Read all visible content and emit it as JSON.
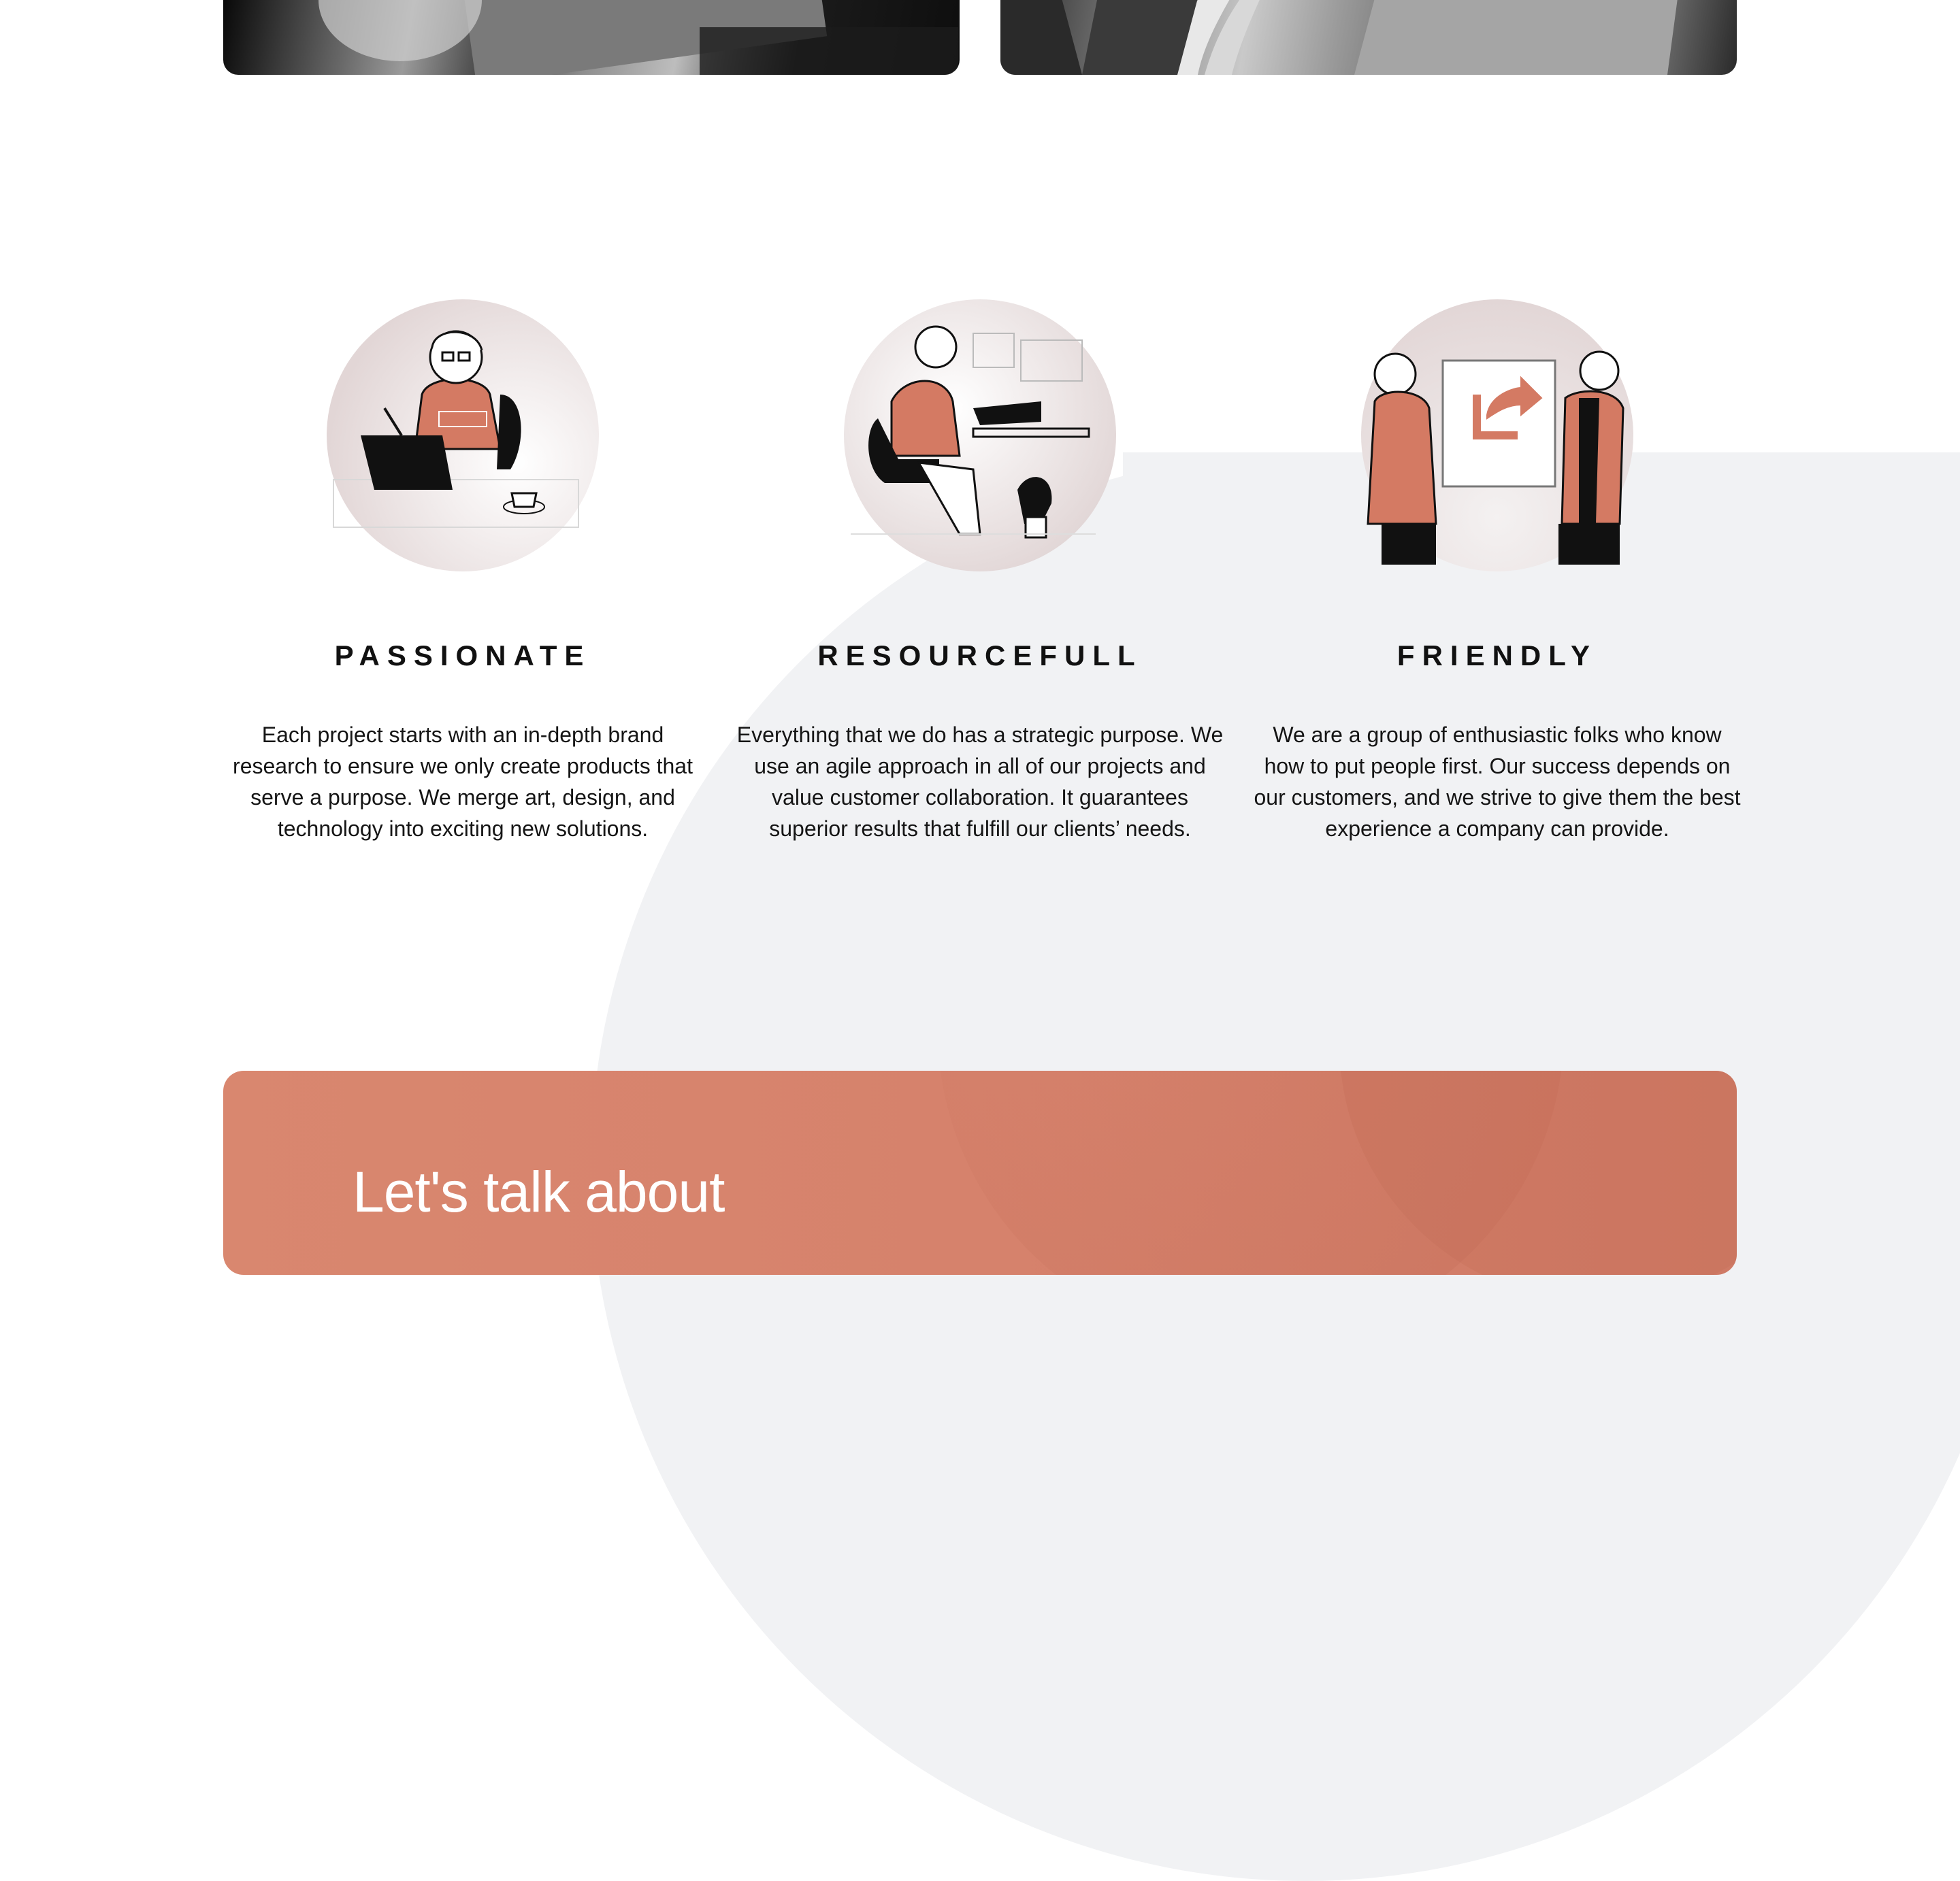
{
  "features": [
    {
      "title": "PASSIONATE",
      "text": "Each project starts with an in-depth brand research to ensure we only create products that serve a purpose. We merge art, design, and technology into exciting new solutions."
    },
    {
      "title": "RESOURCEFULL",
      "text": "Everything that we do has a strategic purpose. We use an agile approach in all of our projects and value customer collaboration. It guarantees superior results that fulfill our clients’ needs."
    },
    {
      "title": "FRIENDLY",
      "text": "We are a group of enthusiastic folks who know how to put people first. Our success depends on our customers, and we strive to give them the best experience a company can provide."
    }
  ],
  "cta": {
    "heading": "Let's talk about"
  },
  "colors": {
    "accent": "#d6826c",
    "dark": "#111111",
    "soft_bg": "#f1f2f4"
  }
}
